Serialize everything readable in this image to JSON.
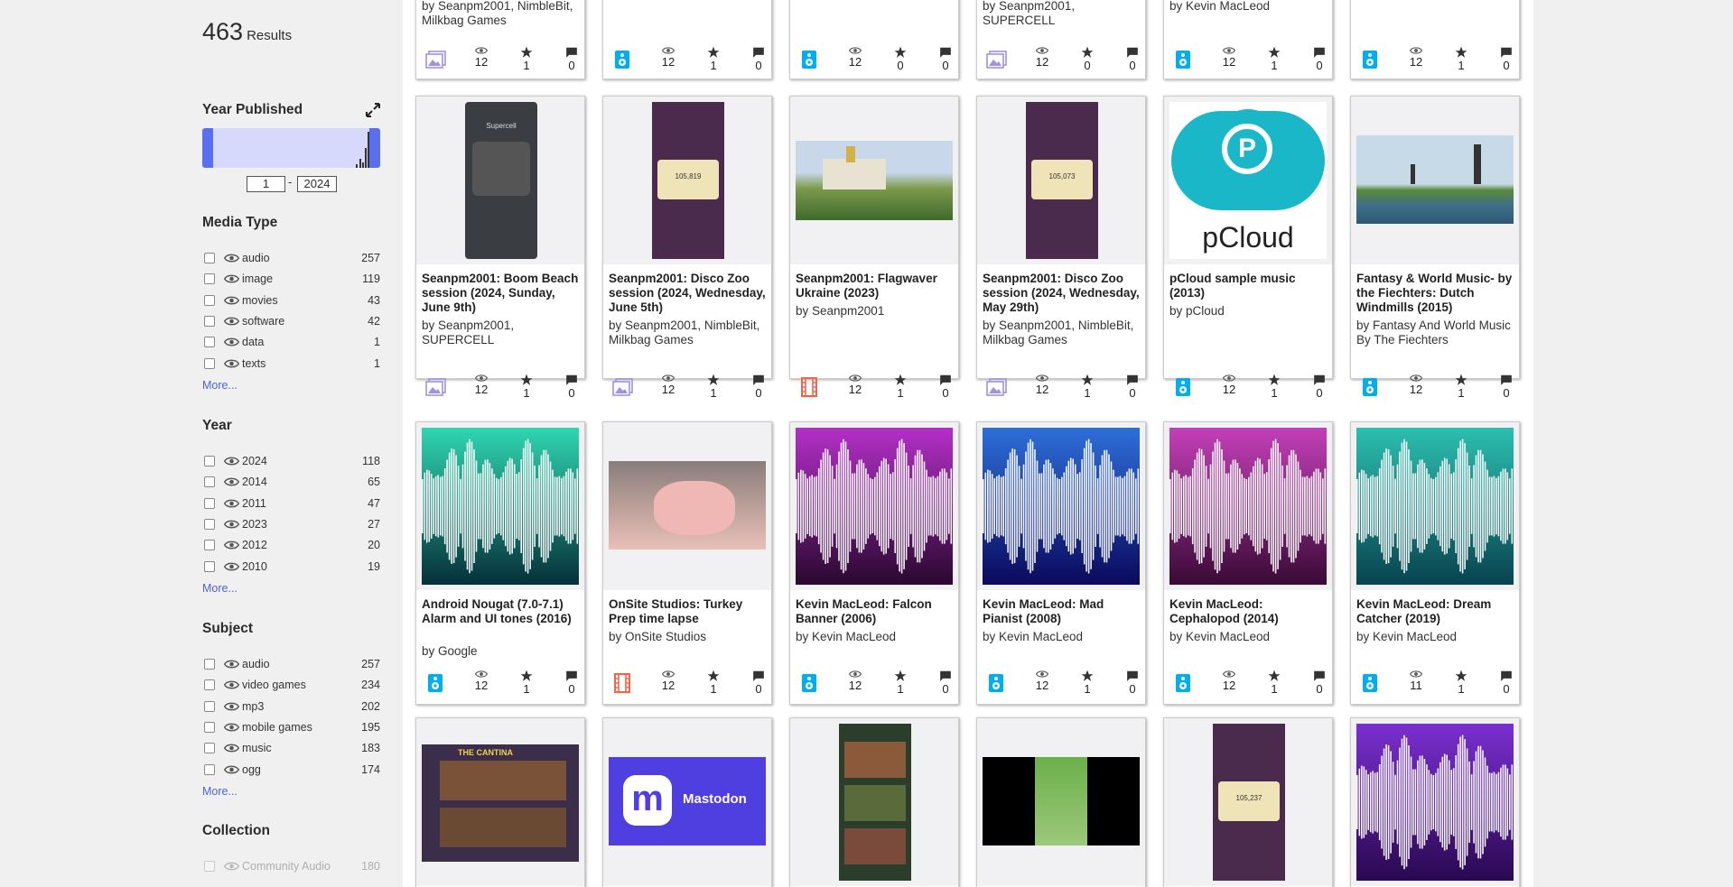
{
  "results": {
    "count": "463",
    "label": "Results"
  },
  "year_published": {
    "title": "Year Published",
    "from": "1",
    "to": "2024",
    "dash": "-"
  },
  "facets": {
    "media_type": {
      "title": "Media Type",
      "more": "More...",
      "items": [
        {
          "label": "audio",
          "count": "257"
        },
        {
          "label": "image",
          "count": "119"
        },
        {
          "label": "movies",
          "count": "43"
        },
        {
          "label": "software",
          "count": "42"
        },
        {
          "label": "data",
          "count": "1"
        },
        {
          "label": "texts",
          "count": "1"
        }
      ]
    },
    "year": {
      "title": "Year",
      "more": "More...",
      "items": [
        {
          "label": "2024",
          "count": "118"
        },
        {
          "label": "2014",
          "count": "65"
        },
        {
          "label": "2011",
          "count": "47"
        },
        {
          "label": "2023",
          "count": "27"
        },
        {
          "label": "2012",
          "count": "20"
        },
        {
          "label": "2010",
          "count": "19"
        }
      ]
    },
    "subject": {
      "title": "Subject",
      "more": "More...",
      "items": [
        {
          "label": "audio",
          "count": "257"
        },
        {
          "label": "video games",
          "count": "234"
        },
        {
          "label": "mp3",
          "count": "202"
        },
        {
          "label": "mobile games",
          "count": "195"
        },
        {
          "label": "music",
          "count": "183"
        },
        {
          "label": "ogg",
          "count": "174"
        }
      ]
    },
    "collection": {
      "title": "Collection",
      "items": [
        {
          "label": "Community Audio",
          "count": "180"
        }
      ]
    }
  },
  "row0": [
    {
      "by": "by Seanpm2001, NimbleBit, Milkbag Games",
      "type": "image",
      "views": "12",
      "favs": "1",
      "reviews": "0"
    },
    {
      "by": "",
      "type": "audio",
      "views": "12",
      "favs": "1",
      "reviews": "0"
    },
    {
      "by": "",
      "type": "audio",
      "views": "12",
      "favs": "0",
      "reviews": "0"
    },
    {
      "by": "by Seanpm2001, SUPERCELL",
      "type": "image",
      "views": "12",
      "favs": "0",
      "reviews": "0"
    },
    {
      "by": "by Kevin MacLeod",
      "type": "audio",
      "views": "12",
      "favs": "1",
      "reviews": "0"
    },
    {
      "by": "",
      "type": "audio",
      "views": "12",
      "favs": "1",
      "reviews": "0"
    }
  ],
  "row1": [
    {
      "title": "Seanpm2001: Boom Beach session (2024, Sunday, June 9th)",
      "by": "by Seanpm2001, SUPERCELL",
      "type": "image",
      "views": "12",
      "favs": "1",
      "reviews": "0",
      "thumb": "phone-dark",
      "thumb_text": "Supercell"
    },
    {
      "title": "Seanpm2001: Disco Zoo session (2024, Wednesday, June 5th)",
      "by": "by Seanpm2001, NimbleBit, Milkbag Games",
      "type": "image",
      "views": "12",
      "favs": "1",
      "reviews": "0",
      "thumb": "phone-zoo",
      "thumb_text": "105,819"
    },
    {
      "title": "Seanpm2001: Flagwaver Ukraine (2023)",
      "by": "by Seanpm2001",
      "type": "movies",
      "views": "12",
      "favs": "1",
      "reviews": "0",
      "thumb": "landscape-church"
    },
    {
      "title": "Seanpm2001: Disco Zoo session (2024, Wednesday, May 29th)",
      "by": "by Seanpm2001, NimbleBit, Milkbag Games",
      "type": "image",
      "views": "12",
      "favs": "1",
      "reviews": "0",
      "thumb": "phone-zoo",
      "thumb_text": "105,073"
    },
    {
      "title": "pCloud sample music (2013)",
      "by": "by pCloud",
      "type": "audio",
      "views": "12",
      "favs": "1",
      "reviews": "0",
      "thumb": "pcloud",
      "thumb_text": "pCloud",
      "thumb_letter": "P"
    },
    {
      "title": "Fantasy & World Music- by the Fiechters: Dutch Windmills (2015)",
      "by": "by Fantasy And World Music By The Fiechters",
      "type": "audio",
      "views": "12",
      "favs": "1",
      "reviews": "0",
      "thumb": "windmills"
    }
  ],
  "row2": [
    {
      "title": "Android Nougat (7.0-7.1) Alarm and UI tones (2016)",
      "by": "by Google",
      "type": "audio",
      "views": "12",
      "favs": "1",
      "reviews": "0",
      "thumb": "wave",
      "c1": "#2fd6b0",
      "c2": "#05303a"
    },
    {
      "title": "OnSite Studios: Turkey Prep time lapse",
      "by": "by OnSite Studios",
      "type": "movies",
      "views": "12",
      "favs": "1",
      "reviews": "0",
      "thumb": "turkey"
    },
    {
      "title": "Kevin MacLeod: Falcon Banner (2006)",
      "by": "by Kevin MacLeod",
      "type": "audio",
      "views": "12",
      "favs": "1",
      "reviews": "0",
      "thumb": "wave",
      "c1": "#b32fc7",
      "c2": "#2a0830"
    },
    {
      "title": "Kevin MacLeod: Mad Pianist (2008)",
      "by": "by Kevin MacLeod",
      "type": "audio",
      "views": "12",
      "favs": "1",
      "reviews": "0",
      "thumb": "wave",
      "c1": "#2d6ed9",
      "c2": "#0a0a5c"
    },
    {
      "title": "Kevin MacLeod: Cephalopod (2014)",
      "by": "by Kevin MacLeod",
      "type": "audio",
      "views": "12",
      "favs": "1",
      "reviews": "0",
      "thumb": "wave",
      "c1": "#c33fb8",
      "c2": "#3a0a36"
    },
    {
      "title": "Kevin MacLeod: Dream Catcher (2019)",
      "by": "by Kevin MacLeod",
      "type": "audio",
      "views": "11",
      "favs": "1",
      "reviews": "0",
      "thumb": "wave",
      "c1": "#2cbfb0",
      "c2": "#08434f"
    }
  ],
  "row3": [
    {
      "thumb": "cantina",
      "thumb_text": "THE CANTINA"
    },
    {
      "thumb": "mastodon",
      "thumb_text": "Mastodon"
    },
    {
      "thumb": "tower"
    },
    {
      "thumb": "city"
    },
    {
      "thumb": "phone-zoo",
      "thumb_text": "105,237"
    },
    {
      "thumb": "wave",
      "c1": "#7a2fd0",
      "c2": "#2a0850"
    }
  ],
  "colors": {
    "audio": "#00adef",
    "image": "#9f92e0",
    "movies": "#f1644b",
    "accent": "#4b64d6"
  }
}
